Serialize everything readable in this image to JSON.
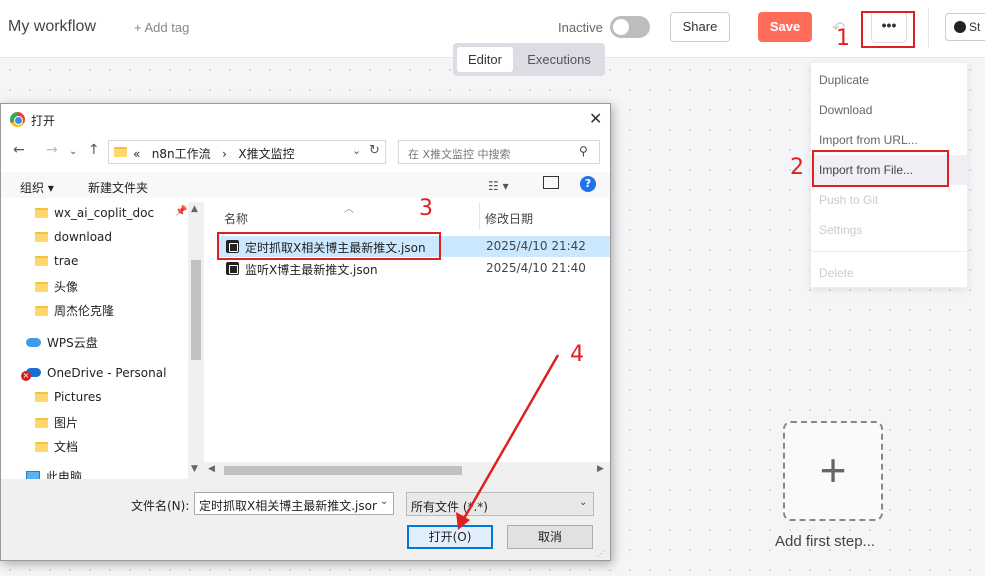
{
  "header": {
    "workflow_title": "My workflow",
    "add_tag": "+ Add tag",
    "active_label": "Inactive",
    "share_label": "Share",
    "save_label": "Save",
    "more_label": "•••",
    "github_label": "St",
    "modes": [
      "Editor",
      "Executions"
    ]
  },
  "menu": {
    "items": [
      {
        "label": "Duplicate",
        "enabled": true
      },
      {
        "label": "Download",
        "enabled": true
      },
      {
        "label": "Import from URL...",
        "enabled": true
      },
      {
        "label": "Import from File...",
        "enabled": true
      },
      {
        "label": "Push to Git",
        "enabled": false
      },
      {
        "label": "Settings",
        "enabled": false
      },
      {
        "label": "Delete",
        "enabled": false
      }
    ]
  },
  "canvas": {
    "add_first_step": "Add first step...",
    "plus": "+"
  },
  "annotations": [
    "1",
    "2",
    "3",
    "4"
  ],
  "dialog": {
    "title": "打开",
    "close": "✕",
    "path_prefix": "«",
    "path": [
      "n8n工作流",
      "X推文监控"
    ],
    "path_sep": "›",
    "search_placeholder": "在 X推文监控 中搜索",
    "toolbar": {
      "organize": "组织 ▾",
      "new_folder": "新建文件夹",
      "help": "?"
    },
    "nav": {
      "folders": [
        "wx_ai_coplit_doc",
        "download",
        "trae",
        "头像",
        "周杰伦克隆"
      ],
      "wps_cloud": "WPS云盘",
      "onedrive": "OneDrive - Personal",
      "onedrive_folders": [
        "Pictures",
        "图片",
        "文档"
      ],
      "this_pc": "此电脑"
    },
    "columns": {
      "name": "名称",
      "modified": "修改日期"
    },
    "files": [
      {
        "name": "定时抓取X相关博主最新推文.json",
        "modified": "2025/4/10 21:42",
        "selected": true
      },
      {
        "name": "监听X博主最新推文.json",
        "modified": "2025/4/10 21:40",
        "selected": false
      }
    ],
    "filename_label": "文件名(N):",
    "filename_value": "定时抓取X相关博主最新推文.json",
    "filetype_value": "所有文件 (*.*)",
    "open_label": "打开(O)",
    "cancel_label": "取消"
  },
  "colors": {
    "save": "#ff6d5a",
    "annotation": "#e02020",
    "selection": "#cce8ff",
    "primary_button_border": "#0078d7"
  }
}
